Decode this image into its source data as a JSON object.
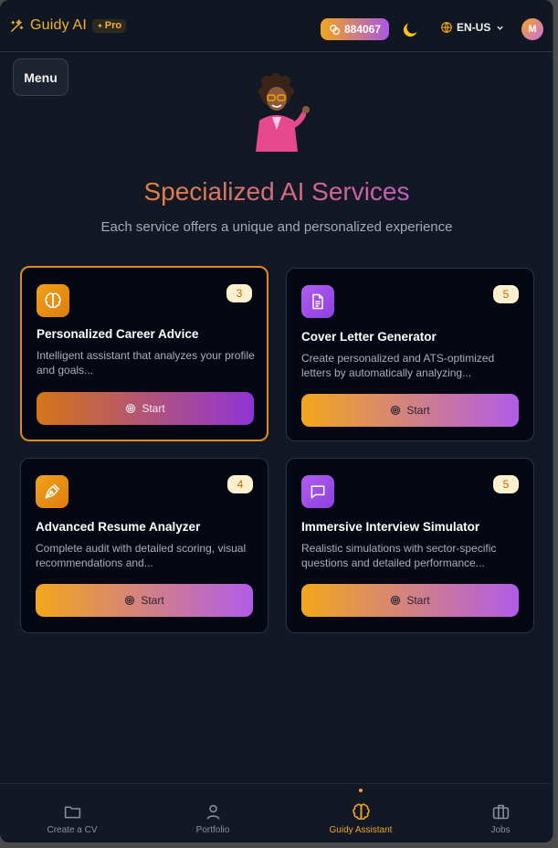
{
  "header": {
    "brand_name": "Guidy AI",
    "pro_label": "Pro",
    "credits": "884067",
    "language": "EN-US",
    "avatar_initial": "M"
  },
  "menu_label": "Menu",
  "hero": {
    "title": "Specialized AI Services",
    "subtitle": "Each service offers a unique and personalized experience"
  },
  "services": [
    {
      "title": "Personalized Career Advice",
      "description": "Intelligent assistant that analyzes your profile and goals...",
      "count": "3",
      "button": "Start",
      "icon": "brain-icon",
      "selected": true
    },
    {
      "title": "Cover Letter Generator",
      "description": "Create personalized and ATS-optimized letters by automatically analyzing...",
      "count": "5",
      "button": "Start",
      "icon": "document-icon",
      "selected": false
    },
    {
      "title": "Advanced Resume Analyzer",
      "description": "Complete audit with detailed scoring, visual recommendations and...",
      "count": "4",
      "button": "Start",
      "icon": "pen-icon",
      "selected": false
    },
    {
      "title": "Immersive Interview Simulator",
      "description": "Realistic simulations with sector-specific questions and detailed performance...",
      "count": "5",
      "button": "Start",
      "icon": "chat-icon",
      "selected": false
    }
  ],
  "bottom_nav": [
    {
      "label": "Create a CV",
      "icon": "folder-icon",
      "active": false
    },
    {
      "label": "Portfolio",
      "icon": "user-icon",
      "active": false
    },
    {
      "label": "Guidy Assistant",
      "icon": "brain-icon",
      "active": true
    },
    {
      "label": "Jobs",
      "icon": "briefcase-icon",
      "active": false
    }
  ],
  "colors": {
    "accent_orange": "#f1a41e",
    "accent_purple": "#a957e6",
    "background": "#121826"
  }
}
